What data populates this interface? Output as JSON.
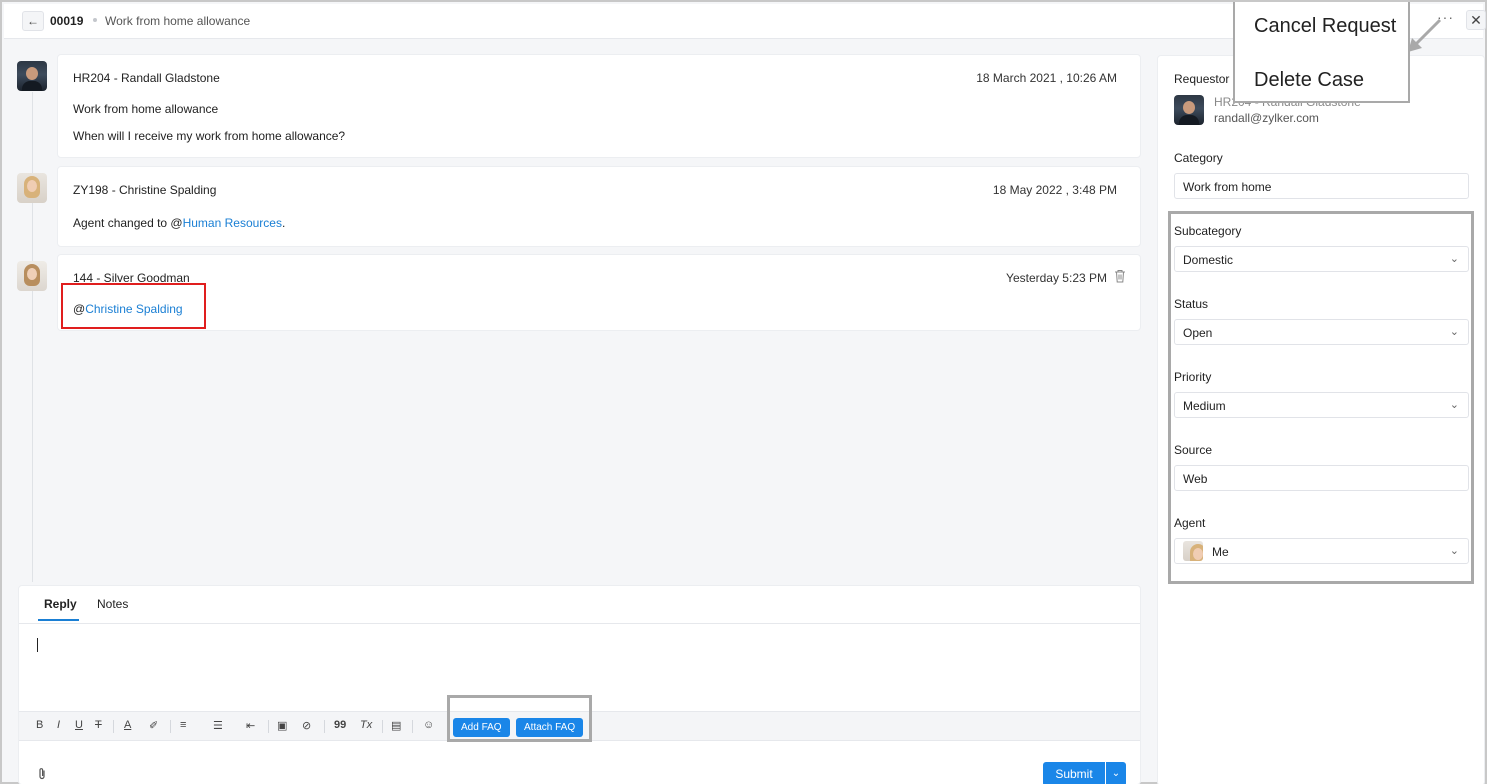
{
  "header": {
    "back_icon": "arrow-left-icon",
    "case_id": "00019",
    "case_title": "Work from home allowance",
    "more_label": "···",
    "close_label": "✕"
  },
  "popup_menu": {
    "items": [
      "Cancel Request",
      "Delete Case"
    ]
  },
  "thread": [
    {
      "author": "HR204 - Randall Gladstone",
      "time": "18 March 2021 , 10:26 AM",
      "lines": [
        "Work from home allowance",
        "When will I receive my work from home allowance?"
      ]
    },
    {
      "author": "ZY198 - Christine Spalding",
      "time": "18 May 2022 , 3:48 PM",
      "text_prefix": "Agent changed to @",
      "mention": "Human Resources",
      "text_suffix": "."
    },
    {
      "author": "144 - Silver Goodman",
      "time": "Yesterday 5:23 PM",
      "text_prefix": "@",
      "mention": "Christine Spalding"
    }
  ],
  "reply": {
    "tabs": [
      "Reply",
      "Notes"
    ],
    "active_tab": "Reply",
    "toolbar": {
      "bold": "B",
      "italic": "I",
      "underline": "U",
      "strike": "T",
      "font_color": "A",
      "highlight": "✐",
      "align": "≡",
      "list": "☰",
      "indent": "⇤",
      "image": "▣",
      "link": "⊘",
      "quote": "99",
      "clear_format": "Tx",
      "block": "▤",
      "emoji": "☺"
    },
    "add_faq": "Add FAQ",
    "attach_faq": "Attach FAQ",
    "submit": "Submit"
  },
  "side": {
    "requestor_label": "Requestor",
    "requestor_name": "HR204 - Randall Gladstone",
    "requestor_email": "randall@zylker.com",
    "category_label": "Category",
    "category_value": "Work from home",
    "subcategory_label": "Subcategory",
    "subcategory_value": "Domestic",
    "status_label": "Status",
    "status_value": "Open",
    "priority_label": "Priority",
    "priority_value": "Medium",
    "source_label": "Source",
    "source_value": "Web",
    "agent_label": "Agent",
    "agent_value": "Me"
  },
  "colors": {
    "accent": "#1a86e8",
    "mention": "#1a7fd4",
    "highlight_red": "#e01e1e",
    "highlight_gray": "#a9a9a9"
  }
}
